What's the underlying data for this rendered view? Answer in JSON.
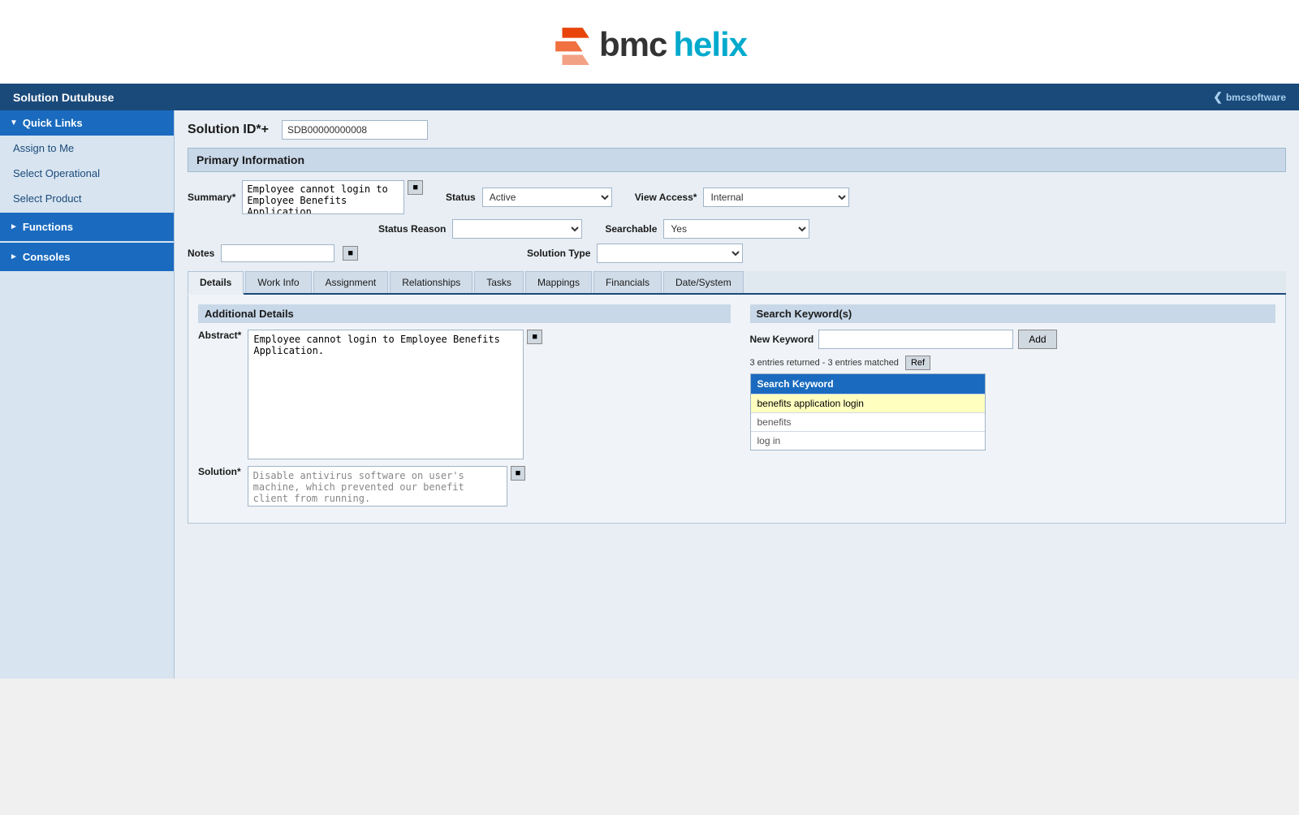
{
  "logo": {
    "bmc_text": "bmc",
    "helix_text": "helix",
    "brand": "bmcsoftware"
  },
  "topbar": {
    "title": "Solution Dutubuse",
    "brand": "bmcsoftware"
  },
  "sidebar": {
    "quick_links_label": "Quick Links",
    "assign_to_me": "Assign to Me",
    "select_operational": "Select Operational",
    "select_product": "Select Product",
    "functions_label": "Functions",
    "consoles_label": "Consoles"
  },
  "form": {
    "solution_id_label": "Solution ID*+",
    "solution_id_value": "SDB00000000008",
    "primary_info_label": "Primary Information",
    "summary_label": "Summary*",
    "summary_value": "Employee cannot login to Employee Benefits Application.",
    "status_label": "Status",
    "status_value": "Active",
    "view_access_label": "View Access*",
    "view_access_value": "Internal",
    "status_reason_label": "Status Reason",
    "status_reason_value": "",
    "searchable_label": "Searchable",
    "searchable_value": "Yes",
    "notes_label": "Notes",
    "notes_value": "",
    "solution_type_label": "Solution Type",
    "solution_type_value": "",
    "tabs": [
      {
        "label": "Details",
        "active": true
      },
      {
        "label": "Work Info",
        "active": false
      },
      {
        "label": "Assignment",
        "active": false
      },
      {
        "label": "Relationships",
        "active": false
      },
      {
        "label": "Tasks",
        "active": false
      },
      {
        "label": "Mappings",
        "active": false
      },
      {
        "label": "Financials",
        "active": false
      },
      {
        "label": "Date/System",
        "active": false
      }
    ],
    "additional_details_label": "Additional Details",
    "abstract_label": "Abstract*",
    "abstract_value": "Employee cannot login to Employee Benefits Application.",
    "solution_label": "Solution*",
    "solution_value": "Disable antivirus software on user's machine, which prevented our benefit client from running.",
    "search_keywords_label": "Search Keyword(s)",
    "new_keyword_label": "New Keyword",
    "new_keyword_value": "",
    "add_btn_label": "Add",
    "results_info": "3 entries returned - 3 entries matched",
    "refresh_btn_label": "Ref",
    "keyword_header": "Search Keyword",
    "keywords": [
      {
        "value": "benefits application login",
        "highlighted": true
      },
      {
        "value": "benefits",
        "highlighted": false
      },
      {
        "value": "log in",
        "highlighted": false
      }
    ]
  }
}
